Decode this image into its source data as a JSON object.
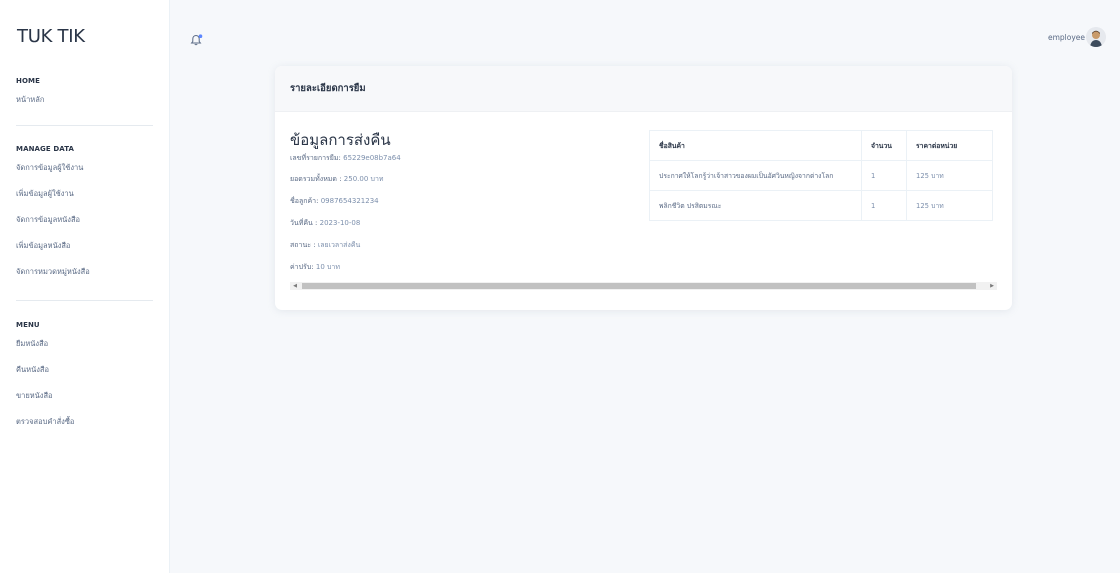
{
  "brand": "TUK TIK",
  "sidebar": {
    "sections": [
      {
        "caption": "HOME",
        "items": [
          "หน้าหลัก"
        ]
      },
      {
        "caption": "MANAGE DATA",
        "items": [
          "จัดการข้อมูลผู้ใช้งาน",
          "เพิ่มข้อมูลผู้ใช้งาน",
          "จัดการข้อมูลหนังสือ",
          "เพิ่มข้อมูลหนังสือ",
          "จัดการหมวดหมู่หนังสือ"
        ]
      },
      {
        "caption": "MENU",
        "items": [
          "ยืมหนังสือ",
          "คืนหนังสือ",
          "ขายหนังสือ",
          "ตรวจสอบคำสั่งซื้อ"
        ]
      }
    ]
  },
  "topbar": {
    "bell_icon": "bell-icon",
    "user_label": "employee"
  },
  "card": {
    "title": "รายละเอียดการยืม",
    "info": {
      "heading": "ข้อมูลการส่งคืน",
      "order_label": "เลขที่รายการยืม:",
      "order_value": "65229e08b7a64",
      "total_label": "ยอดรวมทั้งหมด :",
      "total_value": "250.00 บาท",
      "phone_label": "ชื่อลูกค้า:",
      "phone_value": "0987654321234",
      "date_label": "วันที่คืน :",
      "date_value": "2023-10-08",
      "status_label": "สถานะ :",
      "status_value": "เลยเวลาส่งคืน",
      "fine_label": "ค่าปรับ:",
      "fine_value": "10 บาท"
    },
    "table": {
      "headers": [
        "ชื่อสินค้า",
        "จำนวน",
        "ราคาต่อหน่วย"
      ],
      "rows": [
        [
          "ประกาศให้โลกรู้ว่าเจ้าสาวของผมเป็นอัศวินหญิงจากต่างโลก",
          "1",
          "125 บาท"
        ],
        [
          "พลิกชีวิต ปรสิตมรณะ",
          "1",
          "125 บาท"
        ]
      ]
    }
  }
}
